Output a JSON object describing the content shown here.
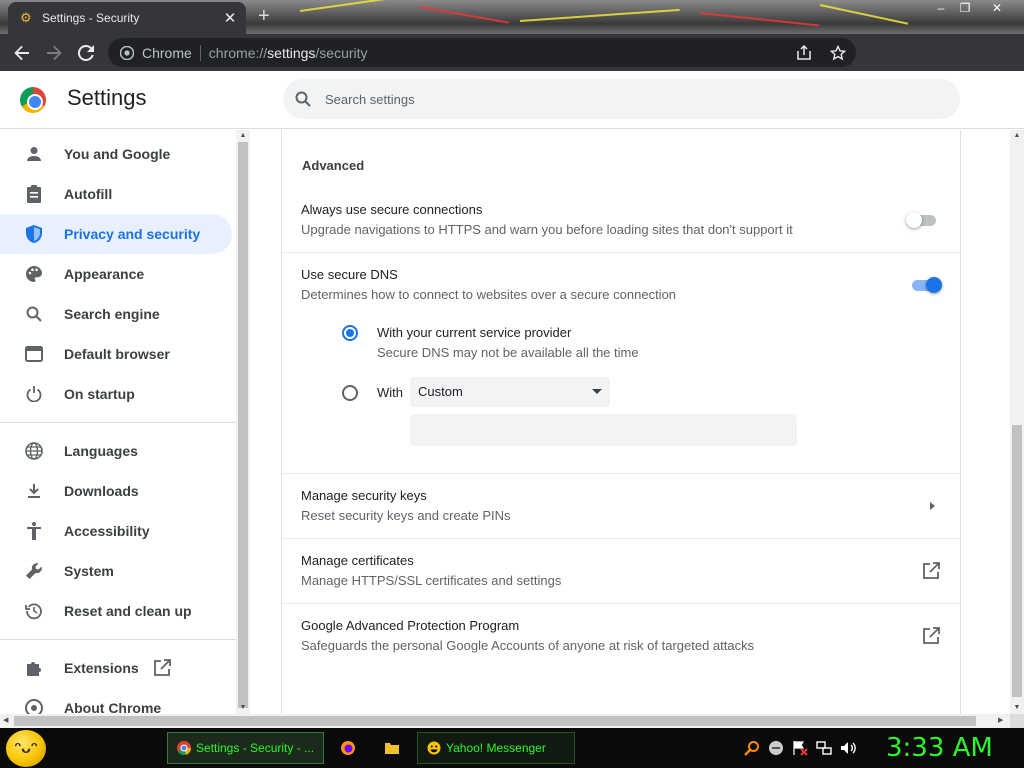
{
  "window": {
    "tab_title": "Settings - Security",
    "tab_close": "✕",
    "new_tab": "+",
    "minimize": "‒",
    "maximize": "❐",
    "close": "✕"
  },
  "toolbar": {
    "site_chip": "Chrome",
    "url_prefix": "chrome://",
    "url_host": "settings",
    "url_path": "/security"
  },
  "header": {
    "title": "Settings",
    "search_placeholder": "Search settings"
  },
  "sidebar": {
    "items": [
      {
        "label": "You and Google",
        "icon": "person-icon"
      },
      {
        "label": "Autofill",
        "icon": "clipboard-icon"
      },
      {
        "label": "Privacy and security",
        "icon": "shield-icon",
        "active": true
      },
      {
        "label": "Appearance",
        "icon": "palette-icon"
      },
      {
        "label": "Search engine",
        "icon": "search-icon"
      },
      {
        "label": "Default browser",
        "icon": "browser-icon"
      },
      {
        "label": "On startup",
        "icon": "power-icon"
      },
      {
        "label": "Languages",
        "icon": "globe-icon"
      },
      {
        "label": "Downloads",
        "icon": "download-icon"
      },
      {
        "label": "Accessibility",
        "icon": "accessibility-icon"
      },
      {
        "label": "System",
        "icon": "wrench-icon"
      },
      {
        "label": "Reset and clean up",
        "icon": "history-icon"
      },
      {
        "label": "Extensions",
        "icon": "puzzle-icon"
      },
      {
        "label": "About Chrome",
        "icon": "chrome-icon"
      }
    ]
  },
  "main": {
    "section_title": "Advanced",
    "https_only": {
      "title": "Always use secure connections",
      "description": "Upgrade navigations to HTTPS and warn you before loading sites that don't support it",
      "enabled": false
    },
    "secure_dns": {
      "title": "Use secure DNS",
      "description": "Determines how to connect to websites over a secure connection",
      "enabled": true,
      "option_current": {
        "title": "With your current service provider",
        "description": "Secure DNS may not be available all the time",
        "selected": true
      },
      "option_custom": {
        "label": "With",
        "provider_value": "Custom",
        "custom_value": "",
        "selected": false
      }
    },
    "security_keys": {
      "title": "Manage security keys",
      "description": "Reset security keys and create PINs"
    },
    "certificates": {
      "title": "Manage certificates",
      "description": "Manage HTTPS/SSL certificates and settings"
    },
    "advanced_protection": {
      "title": "Google Advanced Protection Program",
      "description": "Safeguards the personal Google Accounts of anyone at risk of targeted attacks"
    }
  },
  "taskbar": {
    "start_face": "ᵔᴗᵔ",
    "tasks": [
      {
        "label": "Settings - Security - ..."
      },
      {
        "label": ""
      },
      {
        "label": ""
      },
      {
        "label": "Yahoo! Messenger"
      }
    ],
    "clock": "3:33 AM"
  },
  "colors": {
    "accent": "#1a73e8",
    "active_nav_bg": "#e8f0fe",
    "browser_chrome": "#35363a",
    "taskbar_text": "#2cf52c"
  }
}
